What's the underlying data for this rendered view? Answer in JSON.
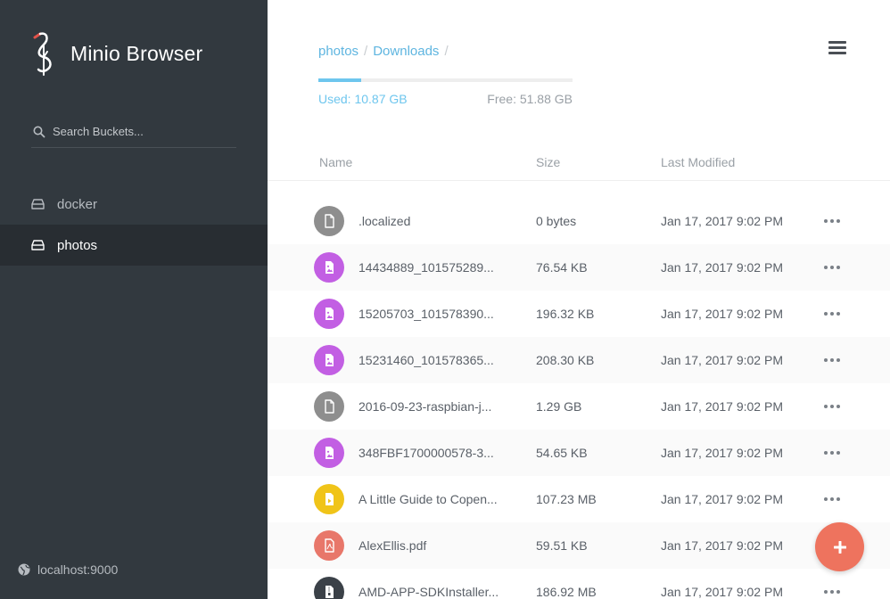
{
  "app": {
    "title": "Minio Browser"
  },
  "search": {
    "placeholder": "Search Buckets..."
  },
  "buckets": [
    {
      "label": "docker",
      "active": false
    },
    {
      "label": "photos",
      "active": true
    }
  ],
  "host": "localhost:9000",
  "breadcrumb": [
    "photos",
    "Downloads"
  ],
  "storage": {
    "used_label": "Used: 10.87 GB",
    "free_label": "Free: 51.88 GB",
    "used_fraction": 0.17
  },
  "columns": {
    "name": "Name",
    "size": "Size",
    "modified": "Last Modified"
  },
  "files": [
    {
      "name": ".localized",
      "size": "0 bytes",
      "modified": "Jan 17, 2017 9:02 PM",
      "icon": "file-icon",
      "color": "#8e8e8e"
    },
    {
      "name": "14434889_101575289...",
      "size": "76.54 KB",
      "modified": "Jan 17, 2017 9:02 PM",
      "icon": "image-icon",
      "color": "#c25fe3"
    },
    {
      "name": "15205703_101578390...",
      "size": "196.32 KB",
      "modified": "Jan 17, 2017 9:02 PM",
      "icon": "image-icon",
      "color": "#c25fe3"
    },
    {
      "name": "15231460_101578365...",
      "size": "208.30 KB",
      "modified": "Jan 17, 2017 9:02 PM",
      "icon": "image-icon",
      "color": "#c25fe3"
    },
    {
      "name": "2016-09-23-raspbian-j...",
      "size": "1.29 GB",
      "modified": "Jan 17, 2017 9:02 PM",
      "icon": "file-icon",
      "color": "#8e8e8e"
    },
    {
      "name": "348FBF1700000578-3...",
      "size": "54.65 KB",
      "modified": "Jan 17, 2017 9:02 PM",
      "icon": "image-icon",
      "color": "#c25fe3"
    },
    {
      "name": "A Little Guide to Copen...",
      "size": "107.23 MB",
      "modified": "Jan 17, 2017 9:02 PM",
      "icon": "video-icon",
      "color": "#f0c419"
    },
    {
      "name": "AlexEllis.pdf",
      "size": "59.51 KB",
      "modified": "Jan 17, 2017 9:02 PM",
      "icon": "pdf-icon",
      "color": "#e8776a"
    },
    {
      "name": "AMD-APP-SDKInstaller...",
      "size": "186.92 MB",
      "modified": "Jan 17, 2017 9:02 PM",
      "icon": "archive-icon",
      "color": "#3b4148"
    }
  ]
}
